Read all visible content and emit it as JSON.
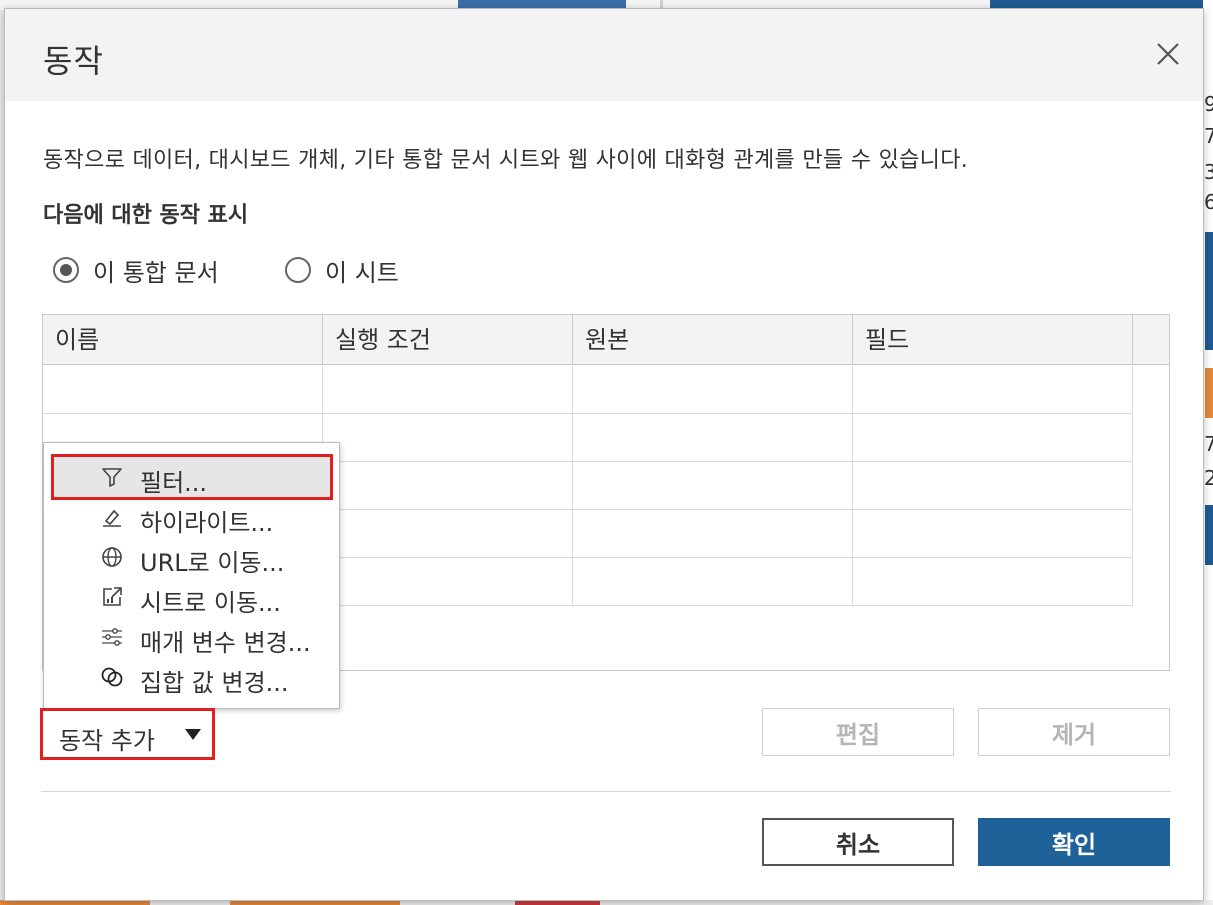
{
  "dialog": {
    "title": "동작",
    "description": "동작으로 데이터, 대시보드 개체, 기타 통합 문서 시트와 웹 사이에 대화형 관계를 만들 수 있습니다.",
    "show_label": "다음에 대한 동작 표시",
    "radios": [
      {
        "label": "이 통합 문서",
        "checked": true
      },
      {
        "label": "이 시트",
        "checked": false
      }
    ],
    "table": {
      "columns": [
        "이름",
        "실행 조건",
        "원본",
        "필드"
      ],
      "rows": []
    },
    "menu": {
      "items": [
        {
          "label": "필터...",
          "icon": "filter-icon"
        },
        {
          "label": "하이라이트...",
          "icon": "highlight-icon"
        },
        {
          "label": "URL로 이동...",
          "icon": "globe-icon"
        },
        {
          "label": "시트로 이동...",
          "icon": "sheet-link-icon"
        },
        {
          "label": "매개 변수 변경...",
          "icon": "sliders-icon"
        },
        {
          "label": "집합 값 변경...",
          "icon": "set-icon"
        }
      ]
    },
    "add_action_label": "동작 추가",
    "edit_label": "편집",
    "remove_label": "제거",
    "cancel_label": "취소",
    "ok_label": "확인"
  },
  "background_digits": [
    "9",
    "7",
    "3",
    "6",
    "7",
    "2"
  ],
  "colors": {
    "primary": "#1f6299",
    "highlight_outline": "#e0201f",
    "disabled_text": "#b5b5b5"
  }
}
